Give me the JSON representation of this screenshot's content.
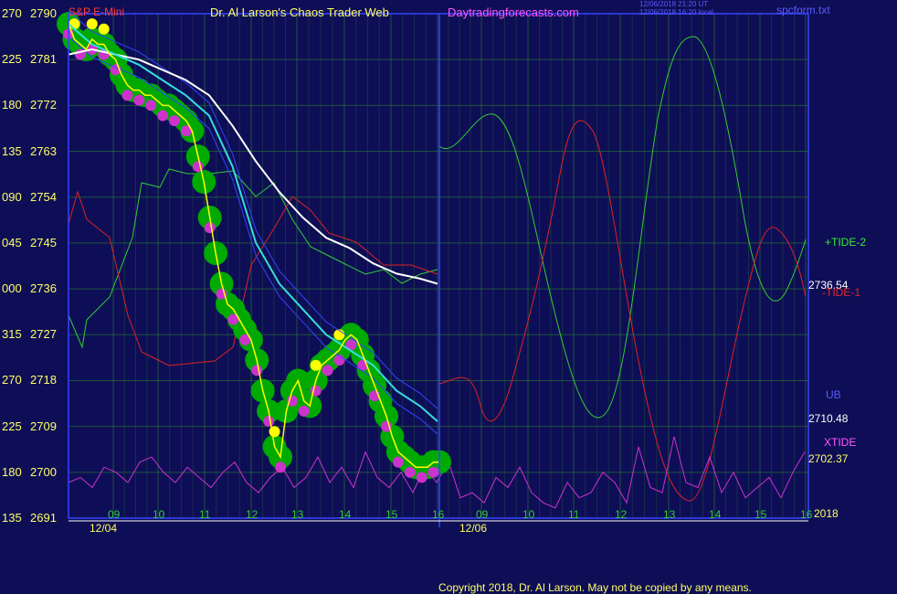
{
  "header": {
    "symbol": "S&P E-Mini",
    "title": "Dr. Al Larson's Chaos Trader Web",
    "site": "Daytradingforecasts.com",
    "timestamp_utc": "12/06/2018 21:20 UT",
    "timestamp_local": "12/06/2018 16:20 local",
    "filename": "spcform.txt"
  },
  "footer": {
    "copyright": "Copyright 2018, Dr. Al Larson. May not be copied by any means."
  },
  "labels": {
    "tide2": "+TIDE-2",
    "tide1": "-TIDE-1",
    "ub": "UB",
    "xtide": "XTIDE",
    "year": "2018"
  },
  "values": {
    "last_price": "2736.54",
    "ub_value": "2710.48",
    "xtide_value": "2702.37"
  },
  "colors": {
    "background": "#0e0e56",
    "grid": "#2a8a2a",
    "price_line": "#ffff00",
    "band": "#00aa00",
    "dots_low": "#cc33cc",
    "dots_high": "#ffff00",
    "avg_slow": "#ffffff",
    "avg_fast": "#33dddd",
    "envelope": "#3344ff",
    "tide_plus": "#33cc33",
    "tide_minus": "#dd2222",
    "xtide": "#cc33cc"
  },
  "chart_data": {
    "type": "line",
    "y_ticks": [
      {
        "angle": "270",
        "price": "2790"
      },
      {
        "angle": "225",
        "price": "2781"
      },
      {
        "angle": "180",
        "price": "2772"
      },
      {
        "angle": "135",
        "price": "2763"
      },
      {
        "angle": "090",
        "price": "2754"
      },
      {
        "angle": "045",
        "price": "2745"
      },
      {
        "angle": "000",
        "price": "2736"
      },
      {
        "angle": "315",
        "price": "2727"
      },
      {
        "angle": "270",
        "price": "2718"
      },
      {
        "angle": "225",
        "price": "2709"
      },
      {
        "angle": "180",
        "price": "2700"
      },
      {
        "angle": "135",
        "price": "2691"
      }
    ],
    "ylim": [
      2691,
      2790
    ],
    "x_hours": [
      "09",
      "10",
      "11",
      "12",
      "13",
      "14",
      "15",
      "16",
      "09",
      "10",
      "11",
      "12",
      "13",
      "14",
      "15",
      "16"
    ],
    "x_dates": [
      "12/04",
      "12/06"
    ],
    "price_series": {
      "name": "S&P E-Mini",
      "x": [
        0,
        0.5,
        1,
        1.5,
        2,
        2.5,
        3,
        3.5,
        4,
        4.5,
        5,
        5.5,
        6,
        6.5,
        7,
        7.5,
        8,
        8.5,
        9,
        9.5,
        10,
        10.5,
        11,
        11.5,
        12,
        12.5,
        13,
        13.5,
        14,
        14.5,
        15,
        15.5,
        16,
        16.5,
        17,
        17.5,
        18,
        18.5,
        19,
        19.5,
        20,
        20.5,
        21,
        21.5,
        22,
        22.5,
        23,
        23.5,
        24,
        24.5,
        25,
        25.5,
        26,
        26.5,
        27,
        27.5,
        28,
        28.5,
        29,
        29.5,
        30,
        30.5,
        31,
        31.5
      ],
      "y": [
        2788,
        2785,
        2784,
        2783,
        2785,
        2784,
        2784,
        2782,
        2781,
        2778,
        2776,
        2775,
        2775,
        2774,
        2774,
        2773,
        2772,
        2772,
        2771,
        2770,
        2769,
        2767,
        2762,
        2757,
        2750,
        2743,
        2737,
        2733,
        2732,
        2730,
        2728,
        2726,
        2722,
        2716,
        2712,
        2705,
        2703,
        2712,
        2716,
        2718,
        2714,
        2713,
        2718,
        2721,
        2722,
        2723,
        2724,
        2726,
        2727,
        2726,
        2723,
        2720,
        2717,
        2714,
        2711,
        2707,
        2704,
        2703,
        2702,
        2701,
        2701,
        2701,
        2702,
        2702
      ]
    },
    "avg_slow": {
      "x": [
        0,
        2,
        4,
        6,
        8,
        10,
        12,
        14,
        16,
        18,
        20,
        22,
        24,
        26,
        28,
        30,
        31.5
      ],
      "y": [
        2782,
        2783,
        2782,
        2781,
        2779,
        2777,
        2774,
        2768,
        2761,
        2755,
        2750,
        2746,
        2744,
        2741,
        2739,
        2738,
        2737
      ]
    },
    "avg_fast": {
      "x": [
        0,
        2,
        4,
        6,
        8,
        10,
        12,
        14,
        16,
        18,
        20,
        22,
        24,
        26,
        28,
        30,
        31.5
      ],
      "y": [
        2788,
        2784,
        2782,
        2780,
        2777,
        2774,
        2770,
        2760,
        2745,
        2737,
        2732,
        2727,
        2724,
        2721,
        2716,
        2713,
        2710
      ]
    },
    "xtide": {
      "x": [
        0,
        1,
        2,
        3,
        4,
        5,
        6,
        7,
        8,
        9,
        10,
        11,
        12,
        13,
        14,
        15,
        16,
        17,
        18,
        19,
        20,
        21,
        22,
        23,
        24,
        25,
        26,
        27,
        28,
        29,
        30,
        31,
        32,
        33,
        34,
        35,
        36,
        37,
        38,
        39,
        40,
        41,
        42,
        43,
        44,
        45,
        46,
        47,
        48,
        49,
        50,
        51,
        52,
        53,
        54,
        55,
        56,
        57,
        58,
        59,
        60,
        61,
        62
      ],
      "y": [
        2698,
        2699,
        2697,
        2701,
        2700,
        2698,
        2702,
        2703,
        2700,
        2698,
        2701,
        2699,
        2697,
        2700,
        2702,
        2698,
        2696,
        2699,
        2701,
        2697,
        2699,
        2703,
        2698,
        2701,
        2697,
        2704,
        2699,
        2697,
        2700,
        2696,
        2701,
        2698,
        2702,
        2695,
        2696,
        2694,
        2699,
        2697,
        2701,
        2696,
        2694,
        2693,
        2698,
        2695,
        2696,
        2700,
        2698,
        2694,
        2705,
        2697,
        2696,
        2707,
        2698,
        2697,
        2703,
        2696,
        2700,
        2695,
        2697,
        2699,
        2695,
        2700,
        2704
      ]
    }
  }
}
